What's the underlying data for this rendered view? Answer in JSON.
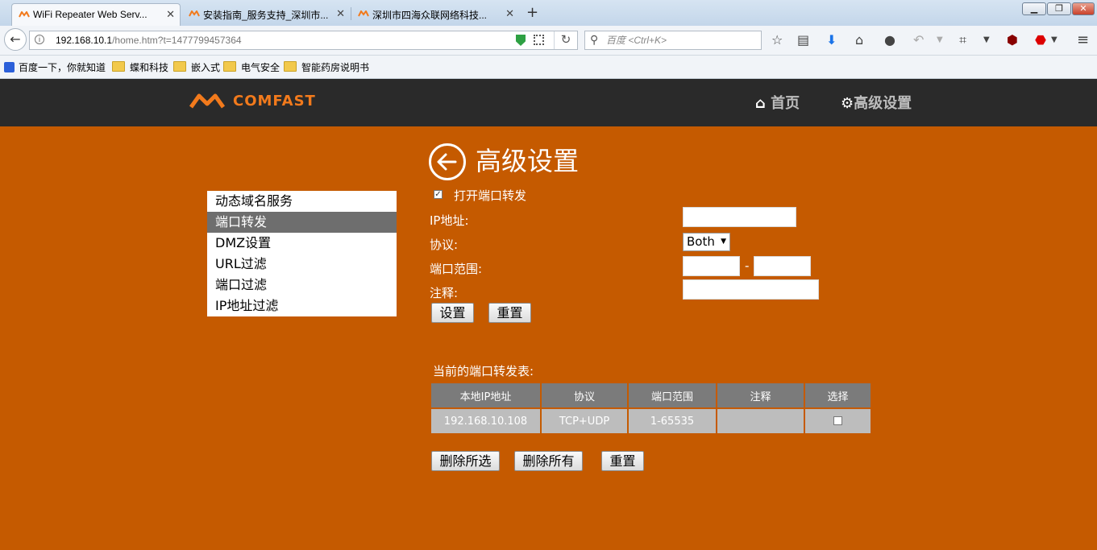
{
  "browser": {
    "tabs": [
      {
        "title": "WiFi Repeater Web Serv...",
        "active": true
      },
      {
        "title": "安装指南_服务支持_深圳市...",
        "active": false
      },
      {
        "title": "深圳市四海众联网络科技...",
        "active": false
      }
    ],
    "url_host": "192.168.10.1",
    "url_path": "/home.htm?t=1477799457364",
    "search_placeholder": "百度 <Ctrl+K>",
    "bookmarks": [
      "百度一下，你就知道",
      "蝶和科技",
      "嵌入式",
      "电气安全",
      "智能药房说明书"
    ]
  },
  "header": {
    "logo_text": "COMFAST",
    "nav": {
      "home": "首页",
      "advanced": "高级设置"
    },
    "logo_color": "#f27a1c"
  },
  "sidebar": {
    "items": [
      "动态域名服务",
      "端口转发",
      "DMZ设置",
      "URL过滤",
      "端口过滤",
      "IP地址过滤"
    ],
    "active_index": 1
  },
  "main": {
    "title": "高级设置",
    "enable_label": "打开端口转发",
    "enable_checked": true,
    "ip_label": "IP地址:",
    "ip_value": "",
    "protocol_label": "协议:",
    "protocol_value": "Both",
    "port_range_label": "端口范围:",
    "port_from": "",
    "port_separator": "-",
    "port_to": "",
    "comment_label": "注释:",
    "comment_value": "",
    "set_button": "设置",
    "reset_button": "重置"
  },
  "table": {
    "title": "当前的端口转发表:",
    "headers": [
      "本地IP地址",
      "协议",
      "端口范围",
      "注释",
      "选择"
    ],
    "rows": [
      {
        "ip": "192.168.10.108",
        "protocol": "TCP+UDP",
        "range": "1-65535",
        "comment": "",
        "selected": false
      }
    ]
  },
  "actions": {
    "delete_selected": "删除所选",
    "delete_all": "删除所有",
    "reset": "重置"
  },
  "colors": {
    "page_bg": "#c55a00",
    "header_bg": "#2a2a2a",
    "accent": "#f27a1c"
  }
}
